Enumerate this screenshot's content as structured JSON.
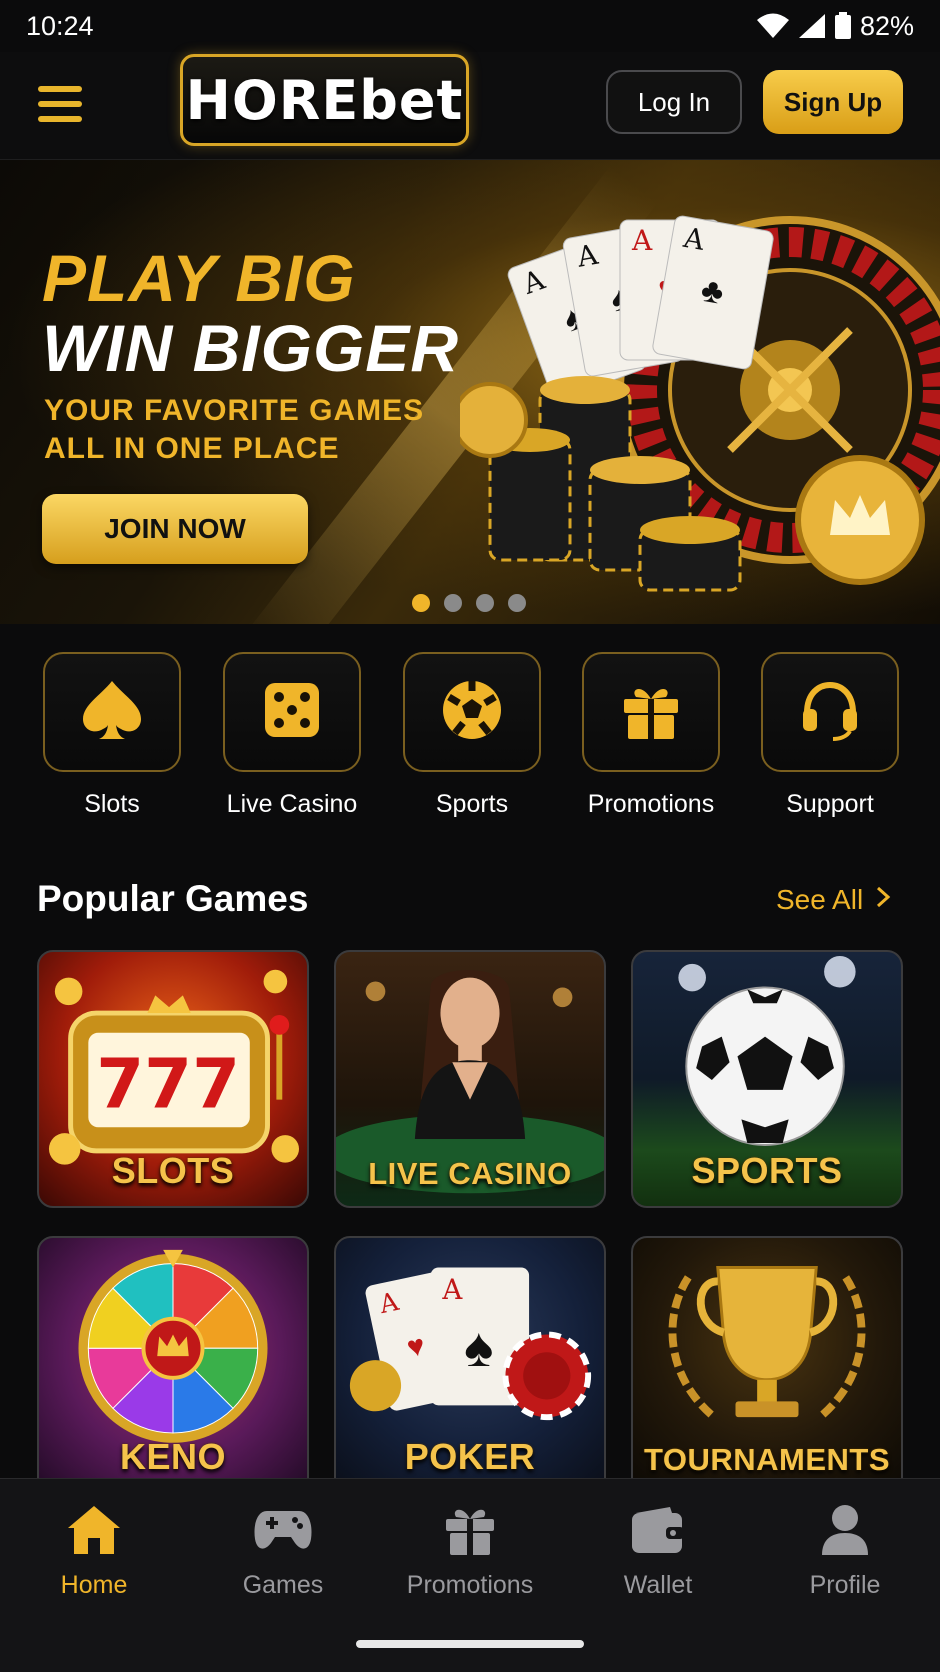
{
  "status_bar": {
    "time": "10:24",
    "battery": "82%"
  },
  "header": {
    "logo_text": "HOREbet",
    "login_label": "Log In",
    "signup_label": "Sign Up"
  },
  "hero": {
    "line1": "PLAY BIG",
    "line2": "WIN BIGGER",
    "sub1": "YOUR FAVORITE GAMES",
    "sub2": "ALL IN ONE PLACE",
    "cta": "JOIN NOW",
    "slide_count": 4,
    "active_slide": 1
  },
  "categories": [
    {
      "label": "Slots",
      "icon": "spade-icon"
    },
    {
      "label": "Live Casino",
      "icon": "dice-icon"
    },
    {
      "label": "Sports",
      "icon": "soccer-ball-icon"
    },
    {
      "label": "Promotions",
      "icon": "gift-icon"
    },
    {
      "label": "Support",
      "icon": "headset-icon"
    }
  ],
  "popular": {
    "title": "Popular Games",
    "see_all": "See All",
    "games": [
      {
        "label": "SLOTS"
      },
      {
        "label": "LIVE CASINO"
      },
      {
        "label": "SPORTS"
      },
      {
        "label": "KENO"
      },
      {
        "label": "POKER"
      },
      {
        "label": "TOURNAMENTS"
      }
    ]
  },
  "bottom_nav": [
    {
      "label": "Home",
      "icon": "home-icon",
      "active": true
    },
    {
      "label": "Games",
      "icon": "gamepad-icon",
      "active": false
    },
    {
      "label": "Promotions",
      "icon": "gift-icon",
      "active": false
    },
    {
      "label": "Wallet",
      "icon": "wallet-icon",
      "active": false
    },
    {
      "label": "Profile",
      "icon": "profile-icon",
      "active": false
    }
  ],
  "colors": {
    "accent": "#f0b52a",
    "background": "#0b0b0c",
    "nav_inactive": "#9a9a9e"
  }
}
